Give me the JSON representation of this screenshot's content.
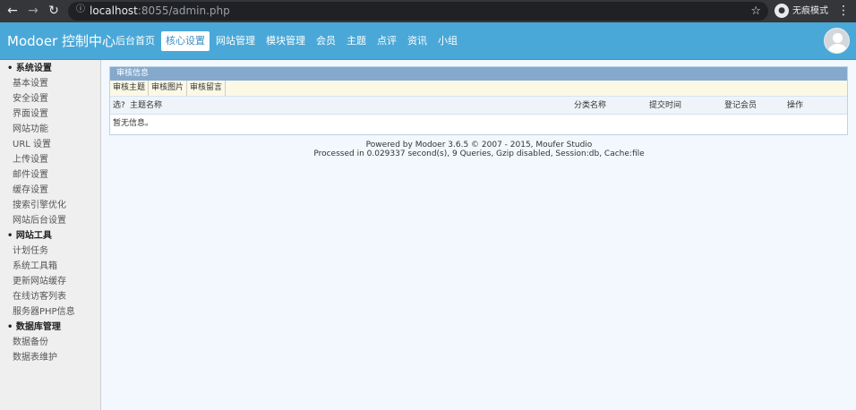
{
  "browser": {
    "url_host": "localhost",
    "url_rest": ":8055/admin.php",
    "incognito_label": "无痕模式"
  },
  "header": {
    "brand": "Modoer 控制中心",
    "nav": [
      "后台首页",
      "核心设置",
      "网站管理",
      "模块管理",
      "会员",
      "主题",
      "点评",
      "资讯",
      "小组"
    ],
    "active_nav": "核心设置"
  },
  "sidebar": {
    "groups": [
      {
        "title": "系统设置",
        "items": [
          "基本设置",
          "安全设置",
          "界面设置",
          "网站功能",
          "URL 设置",
          "上传设置",
          "邮件设置",
          "缓存设置",
          "搜索引擎优化",
          "网站后台设置"
        ]
      },
      {
        "title": "网站工具",
        "items": [
          "计划任务",
          "系统工具箱",
          "更新网站缓存",
          "在线访客列表",
          "服务器PHP信息"
        ]
      },
      {
        "title": "数据库管理",
        "items": [
          "数据备份",
          "数据表维护"
        ]
      }
    ]
  },
  "main": {
    "panel_title": "审核信息",
    "subtabs": [
      "审核主题",
      "审核图片",
      "审核留言"
    ],
    "columns": [
      "选?",
      "主题名称",
      "分类名称",
      "提交时间",
      "登记会员",
      "操作"
    ],
    "empty_text": "暂无信息。"
  },
  "footer": {
    "line1": "Powered by Modoer 3.6.5 © 2007 - 2015, Moufer Studio",
    "line2": "Processed in 0.029337 second(s), 9 Queries, Gzip disabled, Session:db, Cache:file"
  },
  "colors": {
    "header_bg": "#4aa8d8",
    "panel_head_bg": "#84a9cc",
    "subtab_bg": "#fbf9e6",
    "page_bg": "#f2f8fd"
  },
  "icons": [
    "back-arrow-icon",
    "forward-arrow-icon",
    "reload-icon",
    "info-icon",
    "bookmark-star-icon",
    "incognito-icon",
    "menu-dots-icon",
    "user-avatar-icon"
  ]
}
